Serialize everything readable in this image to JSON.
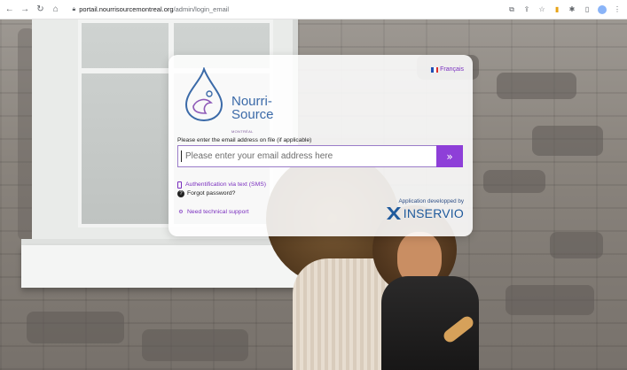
{
  "browser": {
    "url_host": "portail.nourrisourcemontreal.org",
    "url_path": "/admin/login_email",
    "back_icon": "arrow-left-icon",
    "forward_icon": "arrow-right-icon",
    "reload_icon": "reload-icon",
    "home_icon": "home-icon"
  },
  "card": {
    "language_label": "Français",
    "logo": {
      "line1": "Nourri-",
      "line2": "Source",
      "sub": "MONTRÉAL"
    },
    "prompt": "Please enter the email address on file (if applicable)",
    "email_placeholder": "Please enter your email address here",
    "submit_icon": "double-chevron-right-icon",
    "links": {
      "sms": "Authentification via text (SMS)",
      "forgot": "Forgot password?",
      "support": "Need technical support"
    },
    "developer": {
      "label": "Application developped by",
      "name": "INSERVIO"
    }
  },
  "colors": {
    "accent": "#8e3fd8",
    "brand_blue": "#3b6aa8",
    "inservio_blue": "#1f5a9c"
  }
}
